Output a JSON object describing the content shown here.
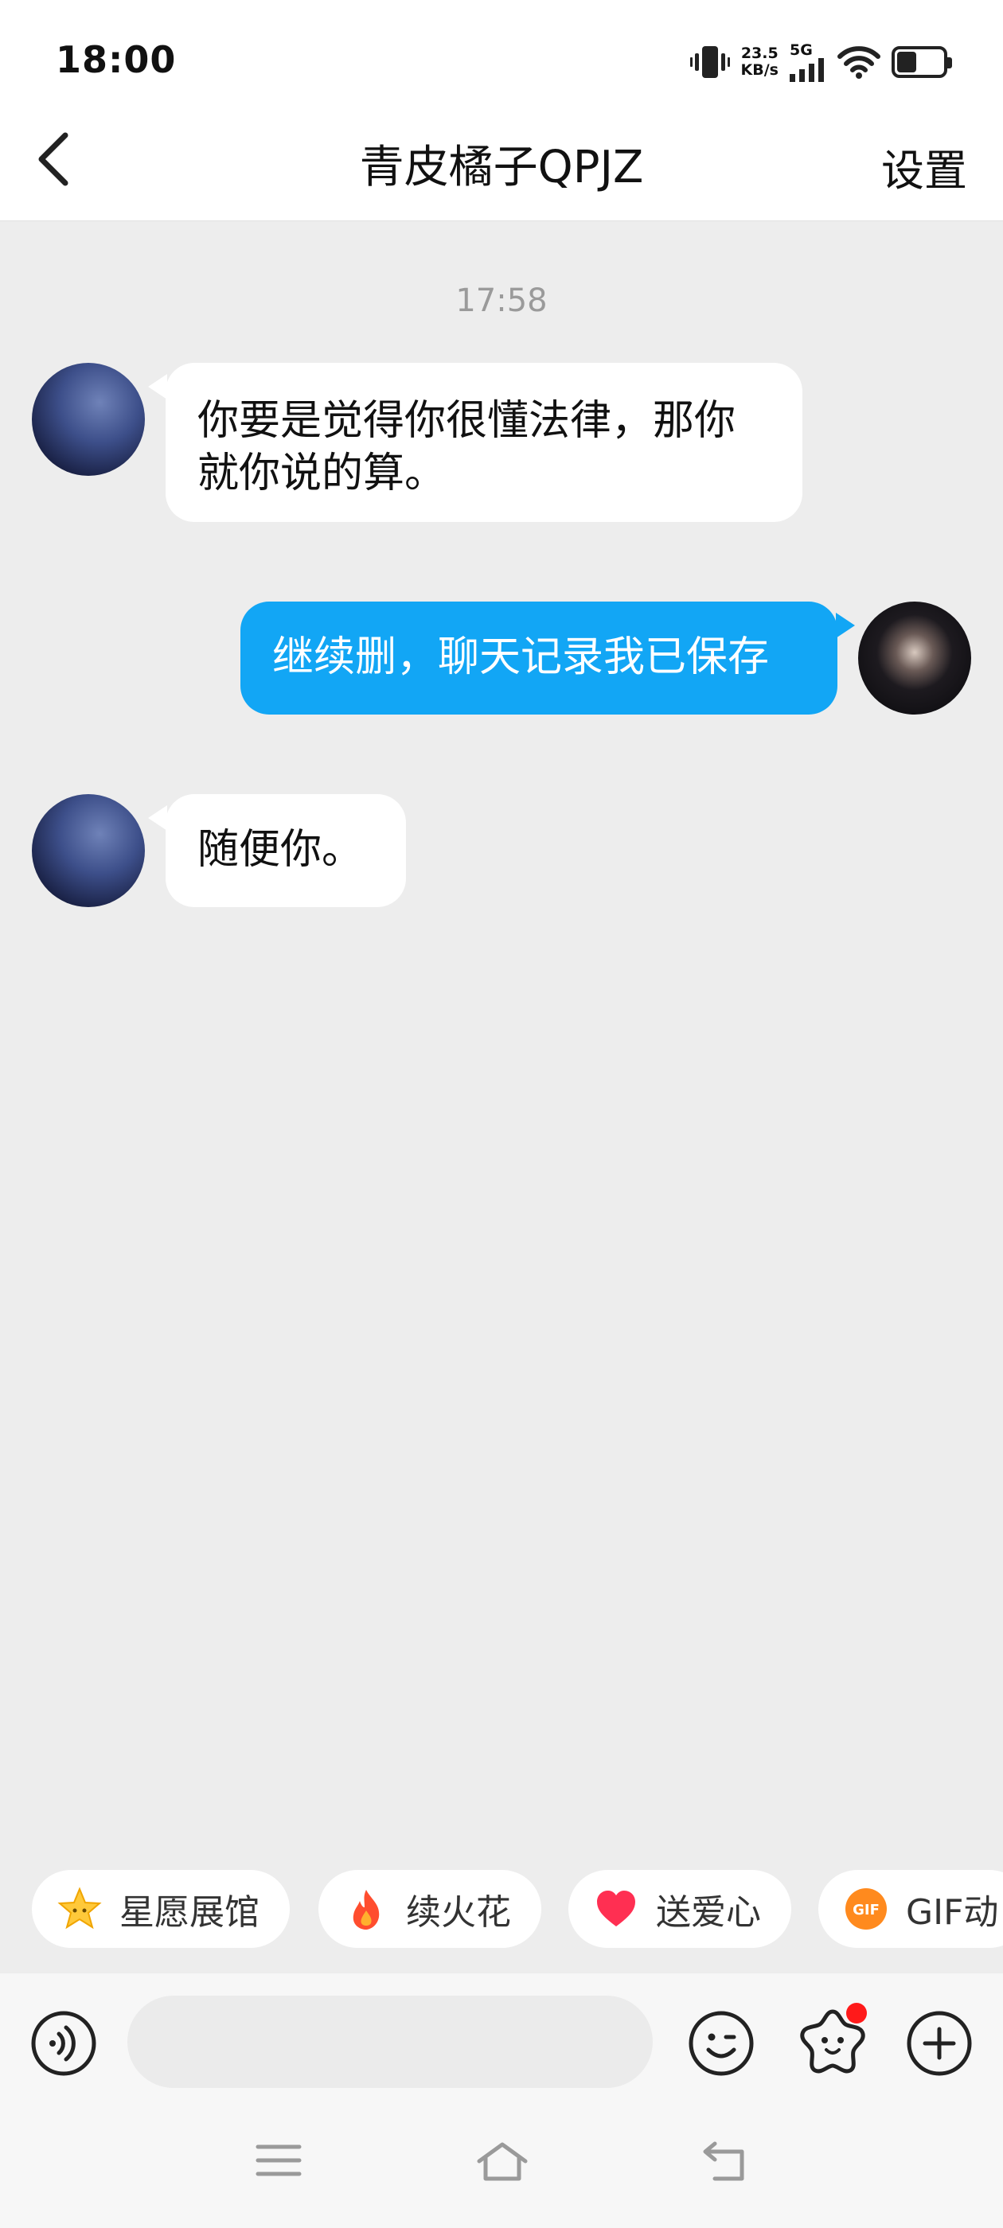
{
  "status": {
    "time": "18:00",
    "speed_value": "23.5",
    "speed_unit": "KB/s",
    "network": "5G"
  },
  "header": {
    "title": "青皮橘子QPJZ",
    "settings_label": "设置"
  },
  "chat": {
    "timestamp": "17:58",
    "messages": [
      {
        "side": "incoming",
        "text_line1": "你要是觉得你很懂法律，那你",
        "text_line2": "就你说的算。"
      },
      {
        "side": "outgoing",
        "text": "继续删，聊天记录我已保存"
      },
      {
        "side": "incoming",
        "text": "随便你。"
      }
    ]
  },
  "quick_actions": [
    {
      "label": "星愿展馆",
      "icon": "star-icon"
    },
    {
      "label": "续火花",
      "icon": "fire-icon"
    },
    {
      "label": "送爱心",
      "icon": "heart-icon"
    },
    {
      "label": "GIF动",
      "icon": "gif-icon"
    }
  ],
  "input_bar": {
    "placeholder": ""
  },
  "colors": {
    "accent": "#12a6f5",
    "background": "#ededed",
    "badge": "#ff1a1a"
  }
}
